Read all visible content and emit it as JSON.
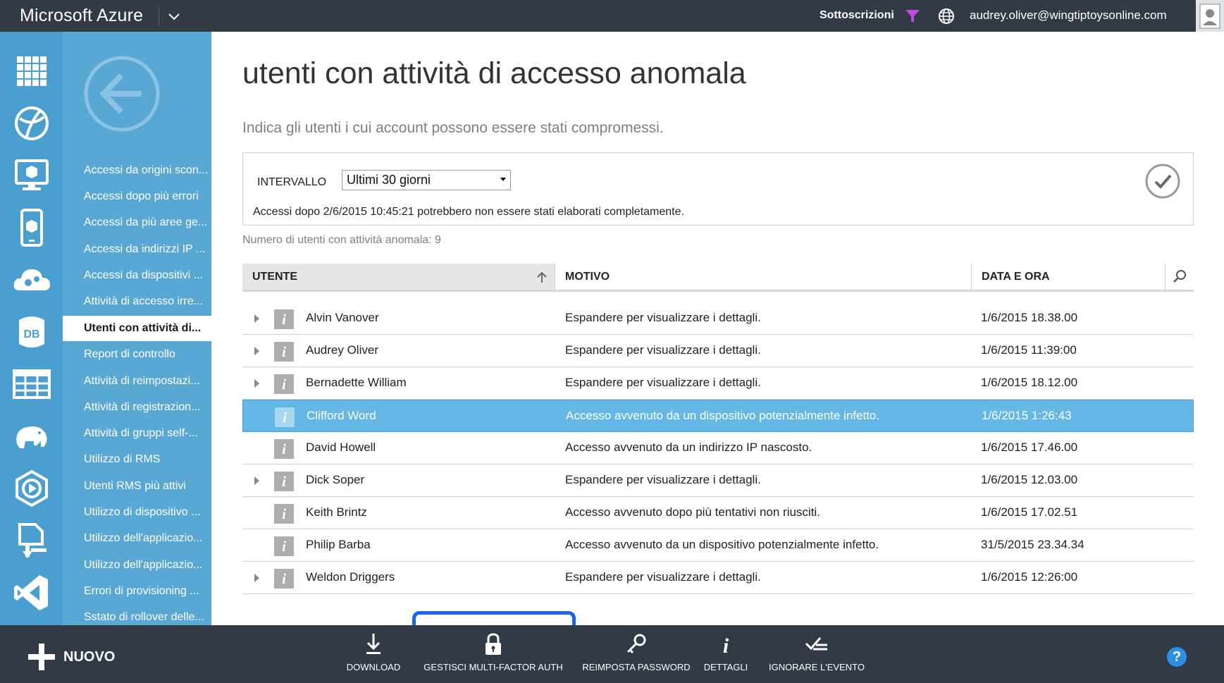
{
  "topbar": {
    "brand": "Microsoft Azure",
    "subscriptions_label": "Sottoscrizioni",
    "user_email": "audrey.oliver@wingtiptoysonline.com"
  },
  "nav": {
    "items": [
      {
        "label": "Accessi da origini scon..."
      },
      {
        "label": "Accessi dopo più errori"
      },
      {
        "label": "Accessi da più aree ge..."
      },
      {
        "label": "Accessi da indirizzi IP ..."
      },
      {
        "label": "Accessi da dispositivi ..."
      },
      {
        "label": "Attività di accesso irre..."
      },
      {
        "label": "Utenti con attività di..."
      },
      {
        "label": "Report di controllo"
      },
      {
        "label": "Attività di reimpostazi..."
      },
      {
        "label": "Attività di registrazion..."
      },
      {
        "label": "Attività di gruppi self-..."
      },
      {
        "label": "Utilizzo di RMS"
      },
      {
        "label": "Utenti RMS più attivi"
      },
      {
        "label": "Utilizzo di dispositivo ..."
      },
      {
        "label": "Utilizzo dell'applicazio..."
      },
      {
        "label": "Utilizzo dell'applicazio..."
      },
      {
        "label": "Errori di provisioning ..."
      },
      {
        "label": "Sstato di rollover delle..."
      }
    ],
    "active_index": 6
  },
  "main": {
    "title": "utenti con attività di accesso anomala",
    "subtitle": "Indica gli utenti i cui account possono essere stati compromessi.",
    "filter": {
      "interval_label": "INTERVALLO",
      "interval_value": "Ultimi 30 giorni",
      "warning": "Accessi dopo 2/6/2015 10:45:21 potrebbero non essere stati elaborati completamente."
    },
    "count_text": "Numero di utenti con attività anomala: 9"
  },
  "table": {
    "headers": {
      "user": "UTENTE",
      "motivo": "MOTIVO",
      "data": "DATA E ORA"
    },
    "rows": [
      {
        "user": "Alvin Vanover",
        "motivo": "Espandere per visualizzare i dettagli.",
        "data": "1/6/2015 18.38.00",
        "expandable": true,
        "selected": false
      },
      {
        "user": "Audrey Oliver",
        "motivo": "Espandere per visualizzare i dettagli.",
        "data": "1/6/2015 11:39:00",
        "expandable": true,
        "selected": false
      },
      {
        "user": "Bernadette William",
        "motivo": "Espandere per visualizzare i dettagli.",
        "data": "1/6/2015 18.12.00",
        "expandable": true,
        "selected": false
      },
      {
        "user": "Clifford Word",
        "motivo": "Accesso avvenuto da un dispositivo potenzialmente infetto.",
        "data": "1/6/2015 1:26:43",
        "expandable": false,
        "selected": true
      },
      {
        "user": "David Howell",
        "motivo": "Accesso avvenuto da un indirizzo IP nascosto.",
        "data": "1/6/2015 17.46.00",
        "expandable": false,
        "selected": false
      },
      {
        "user": "Dick Soper",
        "motivo": "Espandere per visualizzare i dettagli.",
        "data": "1/6/2015 12.03.00",
        "expandable": true,
        "selected": false
      },
      {
        "user": "Keith Brintz",
        "motivo": "Accesso avvenuto dopo più tentativi non riusciti.",
        "data": "1/6/2015 17.02.51",
        "expandable": false,
        "selected": false
      },
      {
        "user": "Philip Barba",
        "motivo": "Accesso avvenuto da un dispositivo potenzialmente infetto.",
        "data": "31/5/2015 23.34.34",
        "expandable": false,
        "selected": false
      },
      {
        "user": "Weldon Driggers",
        "motivo": "Espandere per visualizzare i dettagli.",
        "data": "1/6/2015 12:26:00",
        "expandable": true,
        "selected": false
      }
    ]
  },
  "bottombar": {
    "new_label": "NUOVO",
    "download_label": "DOWNLOAD",
    "mfa_label": "GESTISCI MULTI-FACTOR AUTH",
    "reset_label": "REIMPOSTA PASSWORD",
    "details_label": "DETTAGLI",
    "ignore_label": "IGNORARE L'EVENTO",
    "help_label": "?"
  },
  "colors": {
    "topbar": "#323b45",
    "rail": "#4a9fd0",
    "nav": "#59a8d4",
    "selected_row": "#65b8e6",
    "highlight": "#1d63f2"
  }
}
